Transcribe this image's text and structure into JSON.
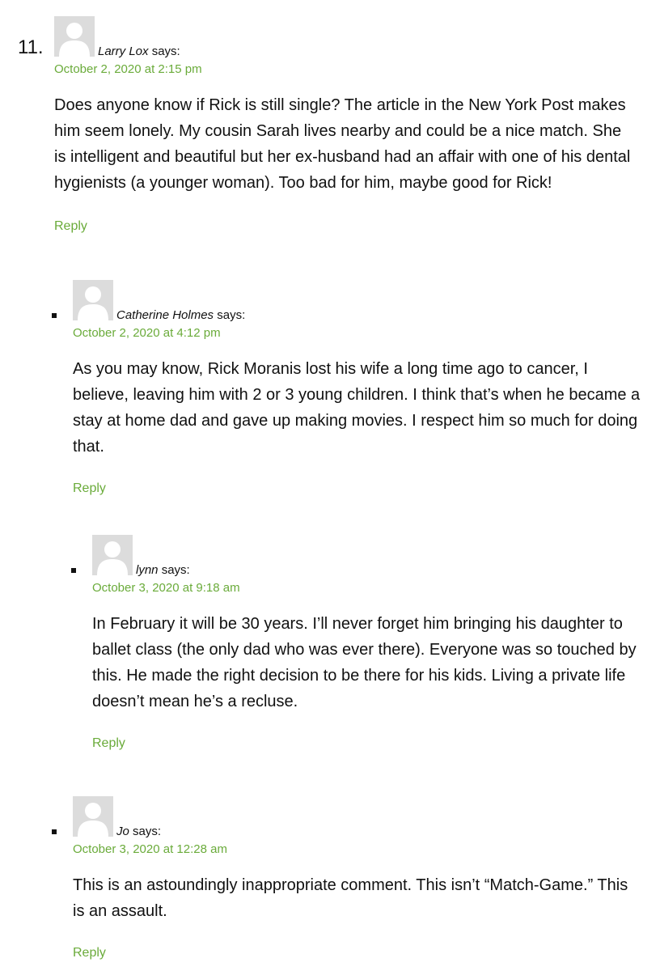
{
  "comments": [
    {
      "number": "11.",
      "author": "Larry Lox",
      "says": " says:",
      "date": "October 2, 2020 at 2:15 pm",
      "body": "Does anyone know if Rick is still single? The article in the New York Post makes him seem lonely. My cousin Sarah lives nearby and could be a nice match. She is intelligent and beautiful but her ex-husband had an affair with one of his dental hygienists (a younger woman). Too bad for him, maybe good for Rick!",
      "reply_label": "Reply"
    },
    {
      "author": "Catherine Holmes",
      "says": " says:",
      "date": "October 2, 2020 at 4:12 pm",
      "body": "As you may know, Rick Moranis lost his wife a long time ago to cancer, I believe, leaving him with 2 or 3 young children. I think that’s when he became a stay at home dad and gave up making movies. I respect him so much for doing that.",
      "reply_label": "Reply"
    },
    {
      "author": "lynn",
      "says": " says:",
      "date": "October 3, 2020 at 9:18 am",
      "body": "In February it will be 30 years. I’ll never forget him bringing his daughter to ballet class (the only dad who was ever there). Everyone was so touched by this. He made the right decision to be there for his kids. Living a private life doesn’t mean he’s a recluse.",
      "reply_label": "Reply"
    },
    {
      "author": "Jo",
      "says": " says:",
      "date": "October 3, 2020 at 12:28 am",
      "body": "This is an astoundingly inappropriate comment. This isn’t “Match-Game.” This is an assault.",
      "reply_label": "Reply"
    }
  ],
  "colors": {
    "link": "#6aab3a",
    "avatar_bg": "#dcdcdc",
    "avatar_figure": "#ffffff"
  },
  "icons": {
    "avatar": "default-avatar-icon",
    "bullet": "square-bullet-icon"
  }
}
